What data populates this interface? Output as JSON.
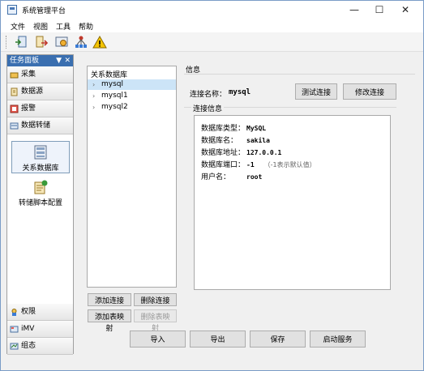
{
  "window": {
    "title": "系统管理平台"
  },
  "menu": [
    "文件",
    "视图",
    "工具",
    "帮助"
  ],
  "toolbar": {
    "icons": [
      "import-icon",
      "export-icon",
      "settings-icon",
      "network-icon",
      "warning-icon"
    ]
  },
  "task_panel": {
    "title": "任务面板",
    "top_categories": [
      {
        "label": "采集",
        "icon": "collect-icon"
      },
      {
        "label": "数据源",
        "icon": "datasource-icon"
      },
      {
        "label": "报警",
        "icon": "alarm-icon"
      },
      {
        "label": "数据转储",
        "icon": "data-dump-icon"
      }
    ],
    "tiles": [
      {
        "label": "关系数据库",
        "icon": "database-icon",
        "selected": true
      },
      {
        "label": "转储脚本配置",
        "icon": "script-config-icon",
        "selected": false
      }
    ],
    "bottom_categories": [
      {
        "label": "权限",
        "icon": "permission-icon"
      },
      {
        "label": "iMV",
        "icon": "imv-icon"
      },
      {
        "label": "组态",
        "icon": "config-icon"
      }
    ]
  },
  "tree": {
    "root": "关系数据库",
    "items": [
      "mysql",
      "mysql1",
      "mysql2"
    ],
    "selected": 0
  },
  "tree_buttons": {
    "add_conn": "添加连接",
    "del_conn": "删除连接",
    "add_map": "添加表映射",
    "del_map": "删除表映射"
  },
  "info": {
    "section_label": "信息",
    "conn_name_label": "连接名称：",
    "conn_name_value": "mysql",
    "test_button": "测试连接",
    "modify_button": "修改连接",
    "group_title": "连接信息",
    "rows": [
      {
        "key": "数据库类型：",
        "value": "MySQL",
        "hint": ""
      },
      {
        "key": "数据库名：",
        "value": "sakila",
        "hint": ""
      },
      {
        "key": "数据库地址：",
        "value": "127.0.0.1",
        "hint": ""
      },
      {
        "key": "数据库端口：",
        "value": "-1",
        "hint": "（-1表示默认值）"
      },
      {
        "key": "用户名：",
        "value": "root",
        "hint": ""
      }
    ]
  },
  "bottom_buttons": {
    "import": "导入",
    "export": "导出",
    "save": "保存",
    "start": "启动服务"
  }
}
